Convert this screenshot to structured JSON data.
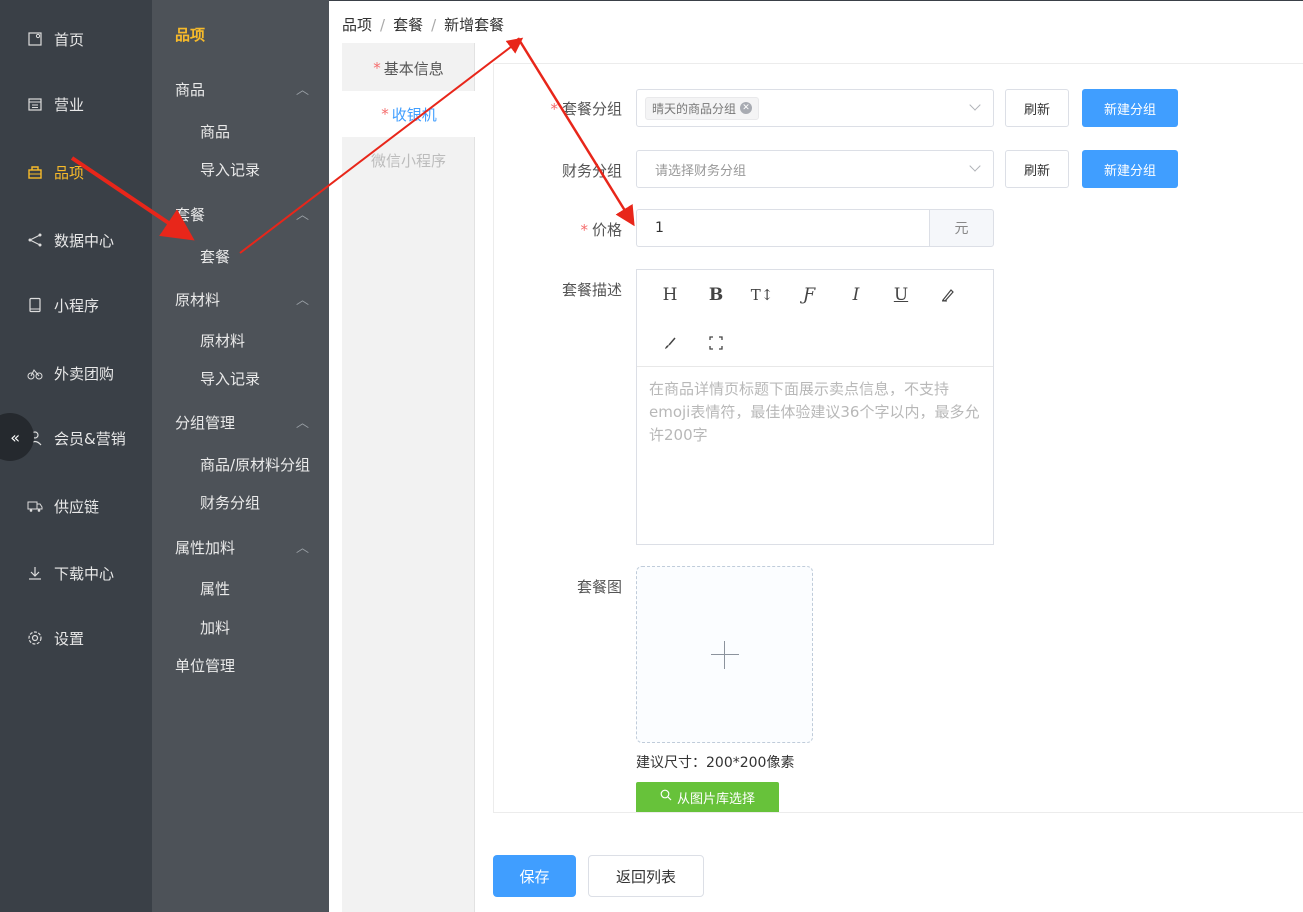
{
  "nav_primary": [
    {
      "label": "首页",
      "icon": "home-icon"
    },
    {
      "label": "营业",
      "icon": "calendar-icon"
    },
    {
      "label": "品项",
      "icon": "bag-icon",
      "active": true
    },
    {
      "label": "数据中心",
      "icon": "share-icon"
    },
    {
      "label": "小程序",
      "icon": "phone-icon"
    },
    {
      "label": "外卖团购",
      "icon": "bike-icon"
    },
    {
      "label": "会员&营销",
      "icon": "user-icon"
    },
    {
      "label": "供应链",
      "icon": "truck-icon"
    },
    {
      "label": "下载中心",
      "icon": "download-icon"
    },
    {
      "label": "设置",
      "icon": "gear-icon"
    }
  ],
  "collapse_glyph": "«",
  "nav_secondary": {
    "title": "品项",
    "groups": [
      {
        "label": "商品",
        "items": [
          "商品",
          "导入记录"
        ]
      },
      {
        "label": "套餐",
        "items": [
          "套餐"
        ]
      },
      {
        "label": "原材料",
        "items": [
          "原材料",
          "导入记录"
        ]
      },
      {
        "label": "分组管理",
        "items": [
          "商品/原材料分组",
          "财务分组"
        ]
      },
      {
        "label": "属性加料",
        "items": [
          "属性",
          "加料"
        ]
      },
      {
        "label": "单位管理",
        "items": []
      }
    ]
  },
  "breadcrumb": [
    "品项",
    "套餐",
    "新增套餐"
  ],
  "tabs": [
    {
      "label": "基本信息",
      "required": true
    },
    {
      "label": "收银机",
      "required": true,
      "active": true
    },
    {
      "label": "微信小程序",
      "required": false
    }
  ],
  "form": {
    "group_label": "套餐分组",
    "group_tag": "晴天的商品分组",
    "finance_label": "财务分组",
    "finance_placeholder": "请选择财务分组",
    "refresh_label": "刷新",
    "new_group_label": "新建分组",
    "price_label": "价格",
    "price_value": "1",
    "price_unit": "元",
    "desc_label": "套餐描述",
    "toolbar": [
      "H",
      "B",
      "T↕",
      "Ƒ",
      "I",
      "U",
      "eraser",
      "brush",
      "fullscreen"
    ],
    "desc_placeholder": "在商品详情页标题下面展示卖点信息，不支持emoji表情符，最佳体验建议36个字以内，最多允许200字",
    "image_label": "套餐图",
    "size_hint": "建议尺寸：200*200像素",
    "gallery_button": "从图片库选择"
  },
  "actions": {
    "save": "保存",
    "back": "返回列表"
  },
  "colors": {
    "primary": "#409eff",
    "active_nav": "#f7ba2a",
    "success": "#67c23a",
    "annotation_arrow": "#e8261a"
  }
}
